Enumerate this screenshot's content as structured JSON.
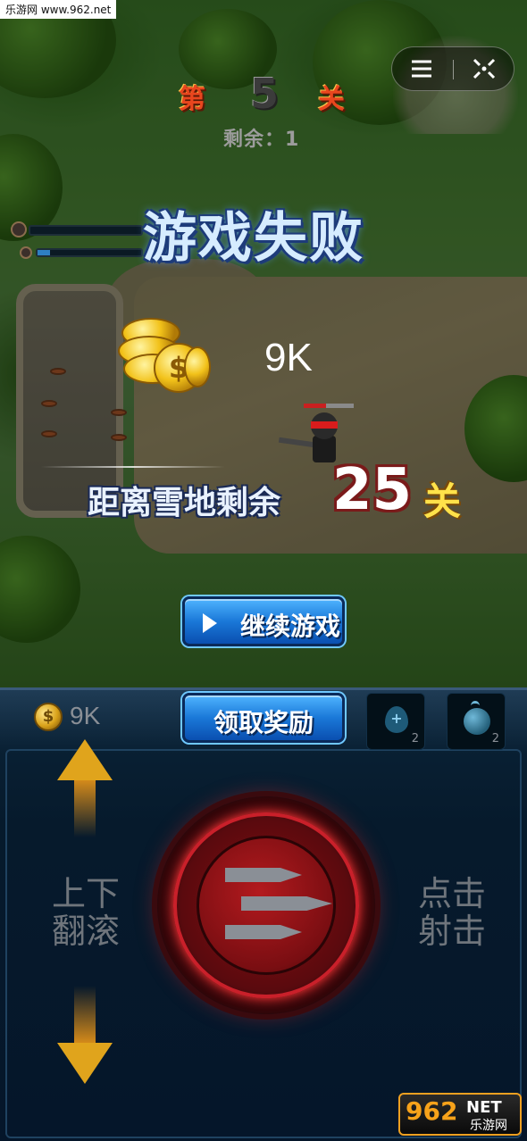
{
  "watermark": {
    "top_left": "乐游网 www.962.net",
    "bottom_right_logo": "962",
    "bottom_right_net": "NET",
    "bottom_right_cn": "乐游网"
  },
  "level": {
    "prefix": "第",
    "number": "5",
    "suffix": "关",
    "remaining": "剩余：1"
  },
  "top_controls": {
    "menu_icon": "menu-icon",
    "close_icon": "target-close-icon"
  },
  "player_bars": {
    "health_fraction": 0.0,
    "shield_fraction": 0.12
  },
  "result": {
    "title": "游戏失败",
    "reward_amount": "9K",
    "snow_label": "距离雪地剩余",
    "snow_levels": "25",
    "snow_unit": "关"
  },
  "buttons": {
    "continue": "继续游戏",
    "claim_reward": "领取奖励"
  },
  "hud": {
    "coin_symbol": "$",
    "coins": "9K",
    "heal_count": "2",
    "bomb_count": "2"
  },
  "controls": {
    "scroll_line1": "上下",
    "scroll_line2": "翻滚",
    "shoot_line1": "点击",
    "shoot_line2": "射击"
  },
  "colors": {
    "fail_title": "#d6ecff",
    "snow_unit": "#ffe24a",
    "fire_button": "#8a0e12",
    "arrow": "#e0a41c",
    "button_blue": "#1a78d8"
  }
}
